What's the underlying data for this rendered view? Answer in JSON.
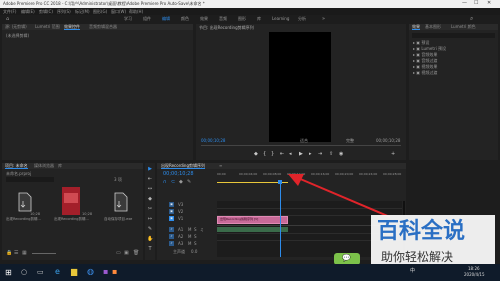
{
  "window": {
    "title": "Adobe Premiere Pro CC 2018 - C:\\用户\\Administrator\\桌面\\教程\\Adobe Premiere Pro Auto-Save\\未命名 *"
  },
  "menubar": {
    "items": [
      "文件(F)",
      "编辑(E)",
      "剪辑(C)",
      "序列(S)",
      "标记(M)",
      "图形(G)",
      "窗口(W)",
      "帮助(H)"
    ]
  },
  "workspaces": {
    "items": [
      "学习",
      "组件",
      "编辑",
      "颜色",
      "效果",
      "音频",
      "图形",
      "库",
      "Learning",
      "分析"
    ],
    "active": "编辑"
  },
  "source_panel": {
    "tabs": [
      "源: (无剪辑)",
      "Lumetri 范围",
      "效果控件",
      "音频剪辑混合器"
    ],
    "active_index": 2,
    "empty_text": "(未选择剪辑)"
  },
  "program_monitor": {
    "title": "节目: 出现Recording剪辑序列",
    "timecode_left": "00;00;10;28",
    "fit_label": "适合",
    "timecode_right": "00;00;10;28",
    "page_label": "完整"
  },
  "right_panel": {
    "tabs": [
      "效果",
      "基本图形",
      "Lumetri 颜色"
    ],
    "items": [
      "预设",
      "Lumetri 预设",
      "音频效果",
      "音频过渡",
      "视频效果",
      "视频过渡"
    ]
  },
  "project_panel": {
    "tabs": [
      "项目: 未命名",
      "媒体浏览器",
      "库"
    ],
    "active_index": 0,
    "filename": "未命名.prproj",
    "item_count": "3 项",
    "items": [
      {
        "name": "出现Recording剪辑...",
        "duration": "10;28",
        "kind": "document"
      },
      {
        "name": "出现Recording剪辑...",
        "duration": "10;28",
        "kind": "video"
      },
      {
        "name": "自动保存项目.exe",
        "duration": "",
        "kind": "document"
      }
    ]
  },
  "timeline": {
    "title": "出现Recording剪辑序列",
    "timecode": "00;00;10;28",
    "ruler_marks": [
      "00;00",
      "00;00;04;00",
      "00;00;08;00",
      "00;00;12;00",
      "00;00;16;00",
      "00;00;20;00",
      "00;00;24;00",
      "00;00;28;00"
    ],
    "video_tracks": [
      "V3",
      "V2",
      "V1"
    ],
    "audio_tracks": [
      "A1",
      "A2",
      "A3"
    ],
    "master_label": "主声道",
    "master_value": "0.0",
    "clip_label": "出现Recording剪辑序列 [V]",
    "playhead_fraction": 0.34
  },
  "tools": [
    "▶",
    "⇤",
    "↔",
    "◆",
    "✂",
    "↦",
    "✎",
    "✋",
    "T"
  ],
  "taskbar": {
    "time": "18:26",
    "date": "2020/4/15",
    "ime": "中"
  },
  "watermark": {
    "title": "百科全说",
    "subtitle": "助你轻松解决"
  },
  "colors": {
    "accent": "#2d8ceb",
    "clip": "#c76a98",
    "arrow": "#e0242a",
    "yellow": "#e8c73a"
  }
}
